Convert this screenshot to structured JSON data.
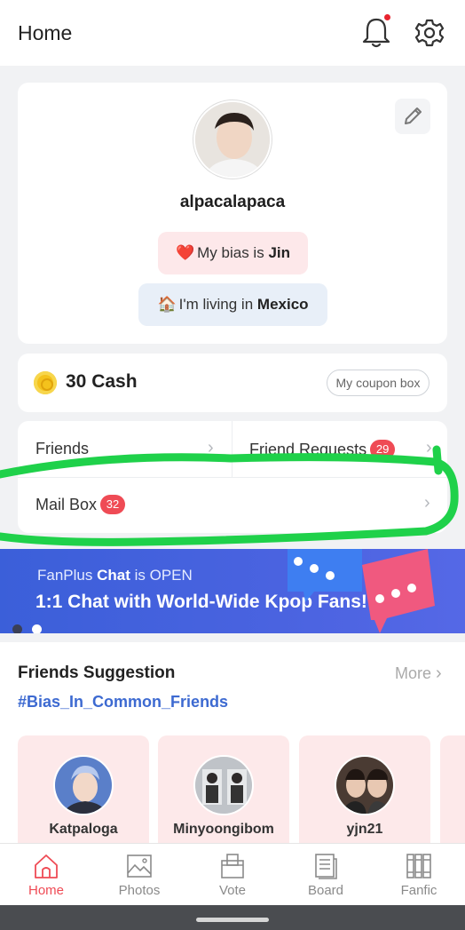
{
  "header": {
    "title": "Home",
    "icons": [
      "bell-icon",
      "gear-icon"
    ],
    "notification_dot_color": "#e8242f"
  },
  "profile": {
    "username": "alpacalapaca",
    "bias_prefix": "My bias is",
    "bias_value": "Jin",
    "bias_emoji": "❤️",
    "living_prefix": "I'm living in",
    "living_value": "Mexico",
    "living_emoji": "🏠"
  },
  "cash": {
    "label": "30 Cash",
    "coupon_button": "My coupon box"
  },
  "menu": {
    "friends": "Friends",
    "friend_requests": "Friend Requests",
    "friend_requests_count": "29",
    "mail_box": "Mail Box",
    "mail_box_count": "32",
    "badge_color": "#ef4b55"
  },
  "banner": {
    "line1_prefix": "FanPlus",
    "line1_bold": "Chat",
    "line1_suffix": "is OPEN",
    "line2": "1:1 Chat with World-Wide Kpop Fans!",
    "page_count": 2,
    "active_page": 2
  },
  "suggestions": {
    "heading": "Friends Suggestion",
    "more": "More",
    "tag": "#Bias_In_Common_Friends",
    "friends": [
      {
        "name": "Katpaloga"
      },
      {
        "name": "Minyoongibom"
      },
      {
        "name": "yjn21"
      }
    ]
  },
  "bottom_nav": {
    "tabs": [
      {
        "label": "Home",
        "icon": "home-icon",
        "active": true
      },
      {
        "label": "Photos",
        "icon": "photos-icon",
        "active": false
      },
      {
        "label": "Vote",
        "icon": "vote-icon",
        "active": false
      },
      {
        "label": "Board",
        "icon": "board-icon",
        "active": false
      },
      {
        "label": "Fanfic",
        "icon": "fanfic-icon",
        "active": false
      }
    ],
    "active_color": "#ef4b55"
  }
}
